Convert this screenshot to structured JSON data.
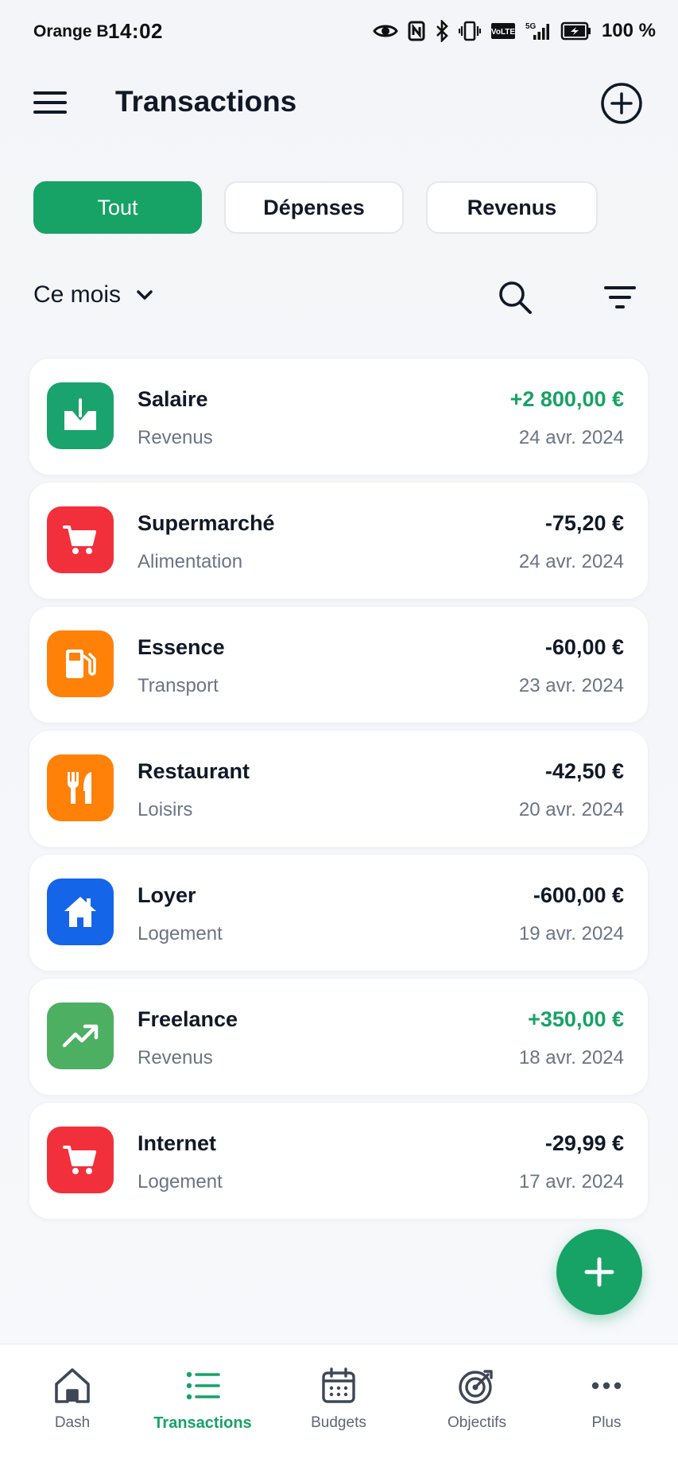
{
  "status_bar": {
    "carrier": "Orange B",
    "time": "14:02",
    "battery_percent": "100 %",
    "network": "5G",
    "volte": "VoLTE"
  },
  "header": {
    "title": "Transactions"
  },
  "tabs": [
    {
      "label": "Tout",
      "active": true
    },
    {
      "label": "Dépenses",
      "active": false
    },
    {
      "label": "Revenus",
      "active": false
    }
  ],
  "period": {
    "label": "Ce mois"
  },
  "transactions": [
    {
      "name": "Salaire",
      "category": "Revenus",
      "amount": "+2 800,00 €",
      "date": "24 avr. 2024",
      "icon": "download-tray-icon",
      "color": "#1aa36c",
      "positive": true
    },
    {
      "name": "Supermarché",
      "category": "Alimentation",
      "amount": "-75,20 €",
      "date": "24 avr. 2024",
      "icon": "shopping-cart-icon",
      "color": "#f2303c",
      "positive": false
    },
    {
      "name": "Essence",
      "category": "Transport",
      "amount": "-60,00 €",
      "date": "23 avr. 2024",
      "icon": "fuel-pump-icon",
      "color": "#ff8108",
      "positive": false
    },
    {
      "name": "Restaurant",
      "category": "Loisirs",
      "amount": "-42,50 €",
      "date": "20 avr. 2024",
      "icon": "fork-knife-icon",
      "color": "#ff8108",
      "positive": false
    },
    {
      "name": "Loyer",
      "category": "Logement",
      "amount": "-600,00 €",
      "date": "19 avr. 2024",
      "icon": "house-icon",
      "color": "#1565e8",
      "positive": false
    },
    {
      "name": "Freelance",
      "category": "Revenus",
      "amount": "+350,00 €",
      "date": "18 avr. 2024",
      "icon": "trending-up-icon",
      "color": "#4caf62",
      "positive": true
    },
    {
      "name": "Internet",
      "category": "Logement",
      "amount": "-29,99 €",
      "date": "17 avr. 2024",
      "icon": "shopping-cart-icon",
      "color": "#f2303c",
      "positive": false
    }
  ],
  "bottom_nav": [
    {
      "label": "Dash",
      "icon": "home-icon",
      "active": false
    },
    {
      "label": "Transactions",
      "icon": "list-icon",
      "active": true
    },
    {
      "label": "Budgets",
      "icon": "calendar-icon",
      "active": false
    },
    {
      "label": "Objectifs",
      "icon": "target-icon",
      "active": false
    },
    {
      "label": "Plus",
      "icon": "more-dots-icon",
      "active": false
    }
  ],
  "colors": {
    "accent": "#17a266",
    "text": "#111827",
    "muted": "#6b7385",
    "background": "#f4f6f9"
  }
}
